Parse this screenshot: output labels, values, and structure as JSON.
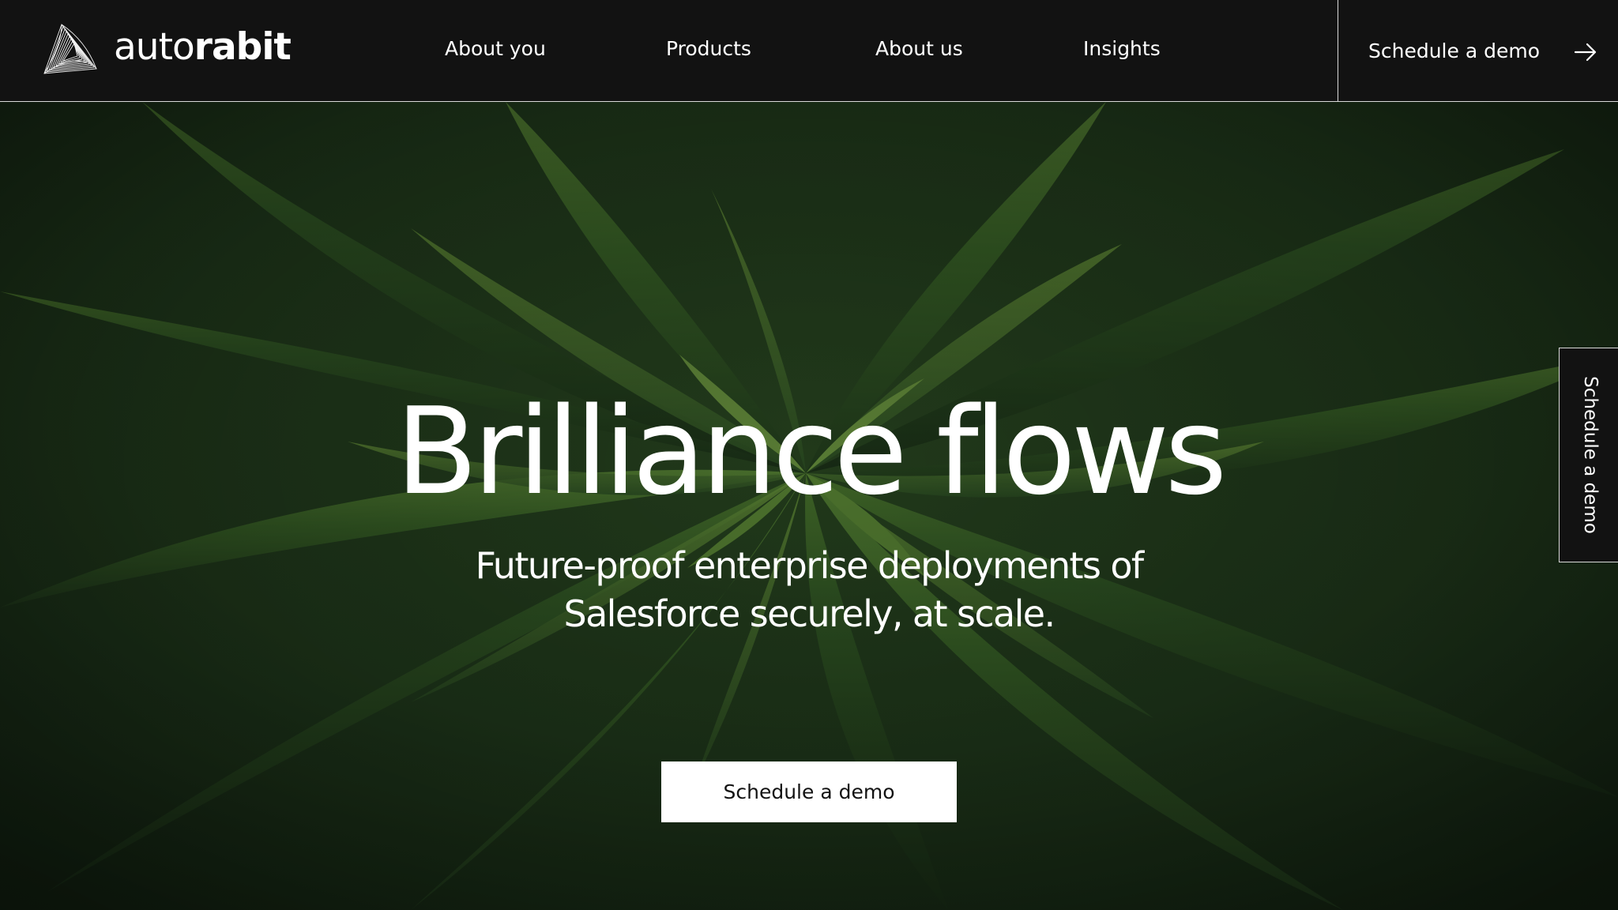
{
  "brand": {
    "name_light": "auto",
    "name_bold": "rabit"
  },
  "nav": {
    "items": [
      {
        "label": "About you"
      },
      {
        "label": "Products"
      },
      {
        "label": "About us"
      },
      {
        "label": "Insights"
      }
    ],
    "cta_label": "Schedule a demo",
    "cta_icon": "arrow-right-icon"
  },
  "hero": {
    "title": "Brilliance flows",
    "subtitle_line1": "Future-proof enterprise deployments of",
    "subtitle_line2": "Salesforce securely, at scale.",
    "button_label": "Schedule a demo",
    "background": "agave-plant-photo"
  },
  "side_tab": {
    "label": "Schedule a demo"
  },
  "colors": {
    "header_bg": "#121212",
    "text_light": "#ffffff",
    "button_bg": "#ffffff",
    "button_text": "#121212",
    "divider": "#d9d9d9",
    "leaf_green": "#3f6b2c"
  }
}
